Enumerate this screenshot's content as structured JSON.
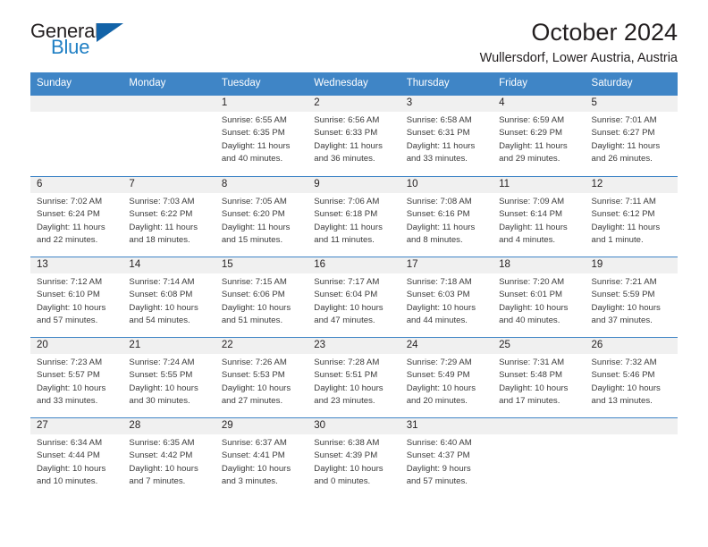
{
  "brand": {
    "line1": "General",
    "line2": "Blue",
    "triangle_icon": "triangle-logo-icon",
    "accent_color": "#1263a8"
  },
  "header": {
    "title": "October 2024",
    "subtitle": "Wullersdorf, Lower Austria, Austria"
  },
  "calendar": {
    "header_bg": "#3f85c6",
    "daynum_bg": "#f0f0f0",
    "weekdays": [
      "Sunday",
      "Monday",
      "Tuesday",
      "Wednesday",
      "Thursday",
      "Friday",
      "Saturday"
    ],
    "labels": {
      "sunrise": "Sunrise:",
      "sunset": "Sunset:",
      "daylight": "Daylight:"
    },
    "weeks": [
      [
        {
          "day": "",
          "empty": true
        },
        {
          "day": "",
          "empty": true
        },
        {
          "day": "1",
          "sunrise": "Sunrise: 6:55 AM",
          "sunset": "Sunset: 6:35 PM",
          "daylight1": "Daylight: 11 hours",
          "daylight2": "and 40 minutes."
        },
        {
          "day": "2",
          "sunrise": "Sunrise: 6:56 AM",
          "sunset": "Sunset: 6:33 PM",
          "daylight1": "Daylight: 11 hours",
          "daylight2": "and 36 minutes."
        },
        {
          "day": "3",
          "sunrise": "Sunrise: 6:58 AM",
          "sunset": "Sunset: 6:31 PM",
          "daylight1": "Daylight: 11 hours",
          "daylight2": "and 33 minutes."
        },
        {
          "day": "4",
          "sunrise": "Sunrise: 6:59 AM",
          "sunset": "Sunset: 6:29 PM",
          "daylight1": "Daylight: 11 hours",
          "daylight2": "and 29 minutes."
        },
        {
          "day": "5",
          "sunrise": "Sunrise: 7:01 AM",
          "sunset": "Sunset: 6:27 PM",
          "daylight1": "Daylight: 11 hours",
          "daylight2": "and 26 minutes."
        }
      ],
      [
        {
          "day": "6",
          "sunrise": "Sunrise: 7:02 AM",
          "sunset": "Sunset: 6:24 PM",
          "daylight1": "Daylight: 11 hours",
          "daylight2": "and 22 minutes."
        },
        {
          "day": "7",
          "sunrise": "Sunrise: 7:03 AM",
          "sunset": "Sunset: 6:22 PM",
          "daylight1": "Daylight: 11 hours",
          "daylight2": "and 18 minutes."
        },
        {
          "day": "8",
          "sunrise": "Sunrise: 7:05 AM",
          "sunset": "Sunset: 6:20 PM",
          "daylight1": "Daylight: 11 hours",
          "daylight2": "and 15 minutes."
        },
        {
          "day": "9",
          "sunrise": "Sunrise: 7:06 AM",
          "sunset": "Sunset: 6:18 PM",
          "daylight1": "Daylight: 11 hours",
          "daylight2": "and 11 minutes."
        },
        {
          "day": "10",
          "sunrise": "Sunrise: 7:08 AM",
          "sunset": "Sunset: 6:16 PM",
          "daylight1": "Daylight: 11 hours",
          "daylight2": "and 8 minutes."
        },
        {
          "day": "11",
          "sunrise": "Sunrise: 7:09 AM",
          "sunset": "Sunset: 6:14 PM",
          "daylight1": "Daylight: 11 hours",
          "daylight2": "and 4 minutes."
        },
        {
          "day": "12",
          "sunrise": "Sunrise: 7:11 AM",
          "sunset": "Sunset: 6:12 PM",
          "daylight1": "Daylight: 11 hours",
          "daylight2": "and 1 minute."
        }
      ],
      [
        {
          "day": "13",
          "sunrise": "Sunrise: 7:12 AM",
          "sunset": "Sunset: 6:10 PM",
          "daylight1": "Daylight: 10 hours",
          "daylight2": "and 57 minutes."
        },
        {
          "day": "14",
          "sunrise": "Sunrise: 7:14 AM",
          "sunset": "Sunset: 6:08 PM",
          "daylight1": "Daylight: 10 hours",
          "daylight2": "and 54 minutes."
        },
        {
          "day": "15",
          "sunrise": "Sunrise: 7:15 AM",
          "sunset": "Sunset: 6:06 PM",
          "daylight1": "Daylight: 10 hours",
          "daylight2": "and 51 minutes."
        },
        {
          "day": "16",
          "sunrise": "Sunrise: 7:17 AM",
          "sunset": "Sunset: 6:04 PM",
          "daylight1": "Daylight: 10 hours",
          "daylight2": "and 47 minutes."
        },
        {
          "day": "17",
          "sunrise": "Sunrise: 7:18 AM",
          "sunset": "Sunset: 6:03 PM",
          "daylight1": "Daylight: 10 hours",
          "daylight2": "and 44 minutes."
        },
        {
          "day": "18",
          "sunrise": "Sunrise: 7:20 AM",
          "sunset": "Sunset: 6:01 PM",
          "daylight1": "Daylight: 10 hours",
          "daylight2": "and 40 minutes."
        },
        {
          "day": "19",
          "sunrise": "Sunrise: 7:21 AM",
          "sunset": "Sunset: 5:59 PM",
          "daylight1": "Daylight: 10 hours",
          "daylight2": "and 37 minutes."
        }
      ],
      [
        {
          "day": "20",
          "sunrise": "Sunrise: 7:23 AM",
          "sunset": "Sunset: 5:57 PM",
          "daylight1": "Daylight: 10 hours",
          "daylight2": "and 33 minutes."
        },
        {
          "day": "21",
          "sunrise": "Sunrise: 7:24 AM",
          "sunset": "Sunset: 5:55 PM",
          "daylight1": "Daylight: 10 hours",
          "daylight2": "and 30 minutes."
        },
        {
          "day": "22",
          "sunrise": "Sunrise: 7:26 AM",
          "sunset": "Sunset: 5:53 PM",
          "daylight1": "Daylight: 10 hours",
          "daylight2": "and 27 minutes."
        },
        {
          "day": "23",
          "sunrise": "Sunrise: 7:28 AM",
          "sunset": "Sunset: 5:51 PM",
          "daylight1": "Daylight: 10 hours",
          "daylight2": "and 23 minutes."
        },
        {
          "day": "24",
          "sunrise": "Sunrise: 7:29 AM",
          "sunset": "Sunset: 5:49 PM",
          "daylight1": "Daylight: 10 hours",
          "daylight2": "and 20 minutes."
        },
        {
          "day": "25",
          "sunrise": "Sunrise: 7:31 AM",
          "sunset": "Sunset: 5:48 PM",
          "daylight1": "Daylight: 10 hours",
          "daylight2": "and 17 minutes."
        },
        {
          "day": "26",
          "sunrise": "Sunrise: 7:32 AM",
          "sunset": "Sunset: 5:46 PM",
          "daylight1": "Daylight: 10 hours",
          "daylight2": "and 13 minutes."
        }
      ],
      [
        {
          "day": "27",
          "sunrise": "Sunrise: 6:34 AM",
          "sunset": "Sunset: 4:44 PM",
          "daylight1": "Daylight: 10 hours",
          "daylight2": "and 10 minutes."
        },
        {
          "day": "28",
          "sunrise": "Sunrise: 6:35 AM",
          "sunset": "Sunset: 4:42 PM",
          "daylight1": "Daylight: 10 hours",
          "daylight2": "and 7 minutes."
        },
        {
          "day": "29",
          "sunrise": "Sunrise: 6:37 AM",
          "sunset": "Sunset: 4:41 PM",
          "daylight1": "Daylight: 10 hours",
          "daylight2": "and 3 minutes."
        },
        {
          "day": "30",
          "sunrise": "Sunrise: 6:38 AM",
          "sunset": "Sunset: 4:39 PM",
          "daylight1": "Daylight: 10 hours",
          "daylight2": "and 0 minutes."
        },
        {
          "day": "31",
          "sunrise": "Sunrise: 6:40 AM",
          "sunset": "Sunset: 4:37 PM",
          "daylight1": "Daylight: 9 hours",
          "daylight2": "and 57 minutes."
        },
        {
          "day": "",
          "empty": true
        },
        {
          "day": "",
          "empty": true
        }
      ]
    ]
  }
}
